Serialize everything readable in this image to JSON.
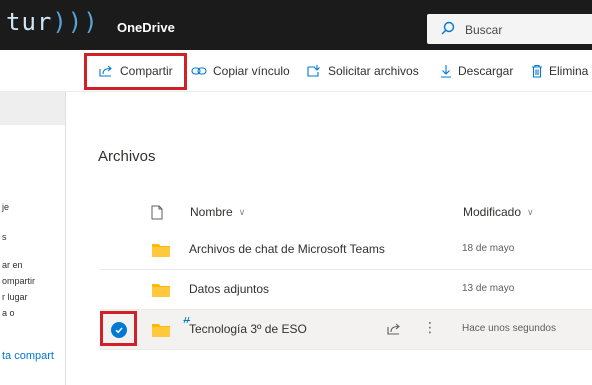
{
  "header": {
    "logo_text": "tur",
    "logo_arcs": ")))",
    "app_name": "OneDrive",
    "search_placeholder": "Buscar"
  },
  "commands": {
    "share": "Compartir",
    "copy_link": "Copiar vínculo",
    "request_files": "Solicitar archivos",
    "download": "Descargar",
    "delete": "Elimina"
  },
  "left_nav": [
    "je",
    "s",
    "ar en",
    "ompartir",
    "r lugar",
    "a o",
    "ta compart"
  ],
  "main": {
    "title": "Archivos",
    "columns": {
      "name": "Nombre",
      "modified": "Modificado"
    },
    "files": [
      {
        "name": "Archivos de chat de Microsoft Teams",
        "modified": "18 de mayo"
      },
      {
        "name": "Datos adjuntos",
        "modified": "13 de mayo"
      },
      {
        "name": "Tecnología 3º de ESO",
        "modified": "Hace unos segundos",
        "selected": true
      }
    ]
  },
  "colors": {
    "accent": "#0078d4",
    "highlight": "#d12128",
    "folder": "#ffb900",
    "topbar": "#1b1b1b"
  }
}
